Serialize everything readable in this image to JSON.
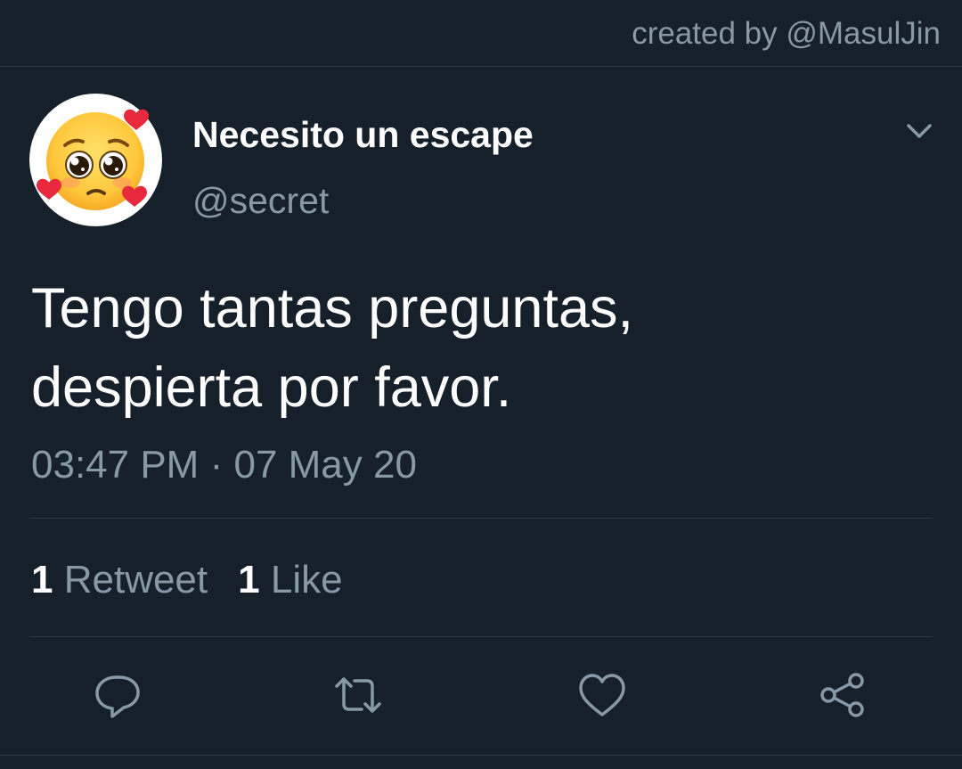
{
  "header": {
    "credit": "created by @MasulJin"
  },
  "tweet": {
    "display_name": "Necesito un escape",
    "handle": "@secret",
    "avatar_icon": "pleading-face-with-hearts-icon",
    "text_lines": [
      "Tengo tantas preguntas,",
      "despierta por favor."
    ],
    "time": "03:47 PM",
    "separator": "·",
    "date": "07 May 20",
    "retweets": {
      "count": "1",
      "label": "Retweet"
    },
    "likes": {
      "count": "1",
      "label": "Like"
    }
  },
  "actions": [
    {
      "icon": "reply-icon"
    },
    {
      "icon": "retweet-icon"
    },
    {
      "icon": "like-icon"
    },
    {
      "icon": "share-icon"
    }
  ],
  "colors": {
    "background": "#15202b",
    "primary_text": "#ffffff",
    "secondary_text": "#8899a6",
    "divider": "#2f3b47"
  }
}
